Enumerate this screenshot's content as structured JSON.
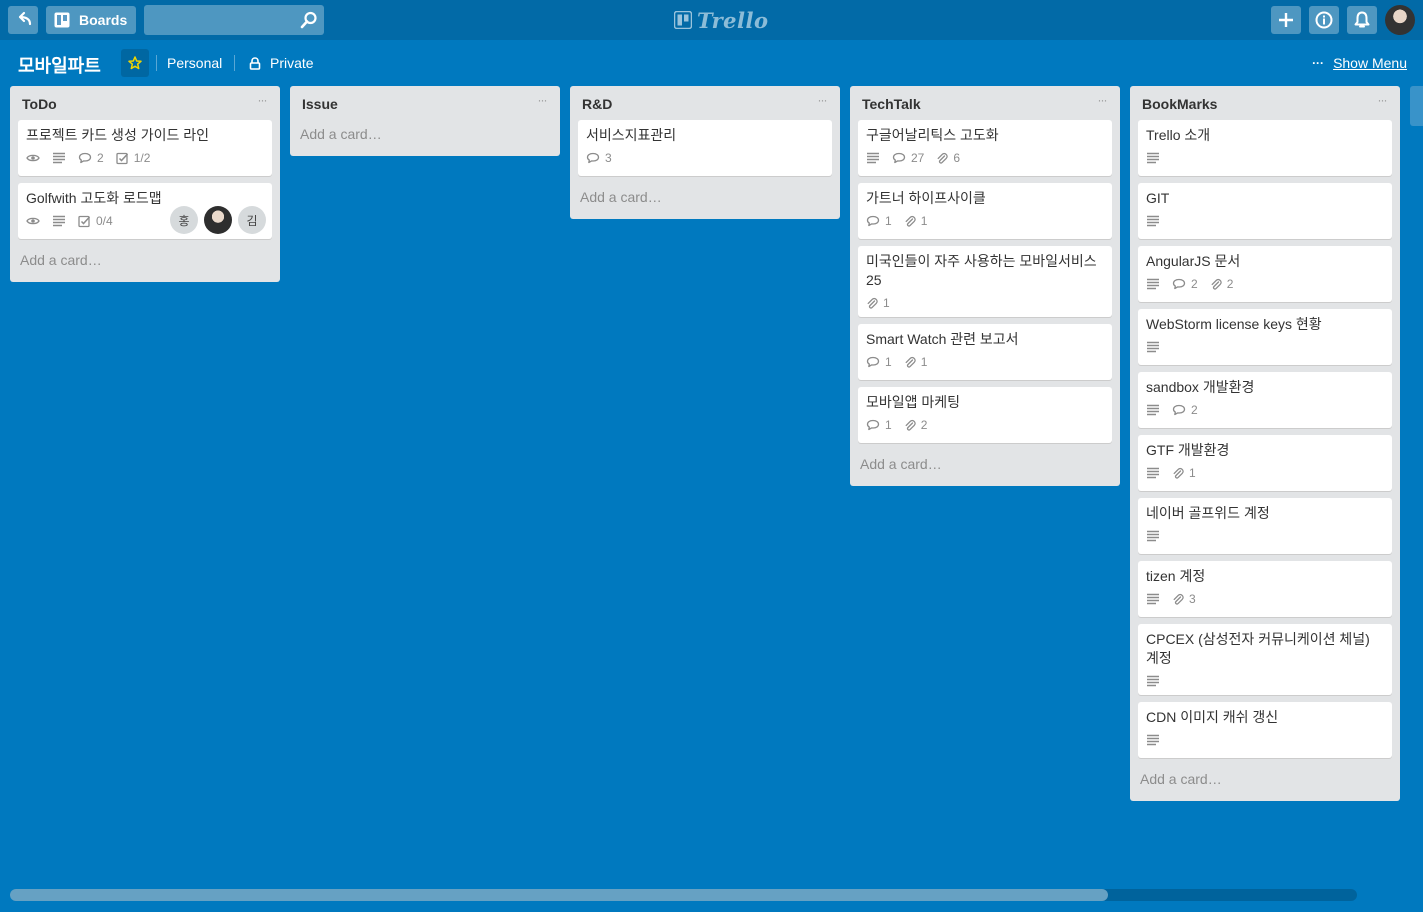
{
  "header": {
    "boards_label": "Boards",
    "search_value": "",
    "logo_text": "Trello"
  },
  "board": {
    "title": "모바일파트",
    "team": "Personal",
    "visibility": "Private",
    "show_menu": "Show Menu",
    "menu_dots": "···"
  },
  "icons": {
    "back": "back-arrow-icon",
    "boards": "boards-icon",
    "search": "search-icon",
    "add": "plus-icon",
    "info": "info-icon",
    "notifications": "bell-icon",
    "star": "star-icon",
    "lock": "lock-icon",
    "watch": "eye-icon",
    "description": "description-icon",
    "comments": "comment-icon",
    "checklist": "checklist-icon",
    "attachments": "paperclip-icon"
  },
  "colors": {
    "background": "#0079bf",
    "header": "#026aa7",
    "list": "#e2e4e6",
    "star": "#f2d600"
  },
  "lists": [
    {
      "title": "ToDo",
      "menu": "···",
      "add_card": "Add a card…",
      "cards": [
        {
          "title": "프로젝트 카드 생성 가이드 라인",
          "watch": true,
          "desc": true,
          "comments": "2",
          "checklist": "1/2",
          "attachments": null,
          "members": []
        },
        {
          "title": "Golfwith 고도화 로드맵",
          "watch": true,
          "desc": true,
          "comments": null,
          "checklist": "0/4",
          "attachments": null,
          "members": [
            "홍",
            "",
            "김"
          ]
        }
      ]
    },
    {
      "title": "Issue",
      "menu": "···",
      "add_card": "Add a card…",
      "cards": []
    },
    {
      "title": "R&D",
      "menu": "···",
      "add_card": "Add a card…",
      "cards": [
        {
          "title": "서비스지표관리",
          "watch": false,
          "desc": false,
          "comments": "3",
          "checklist": null,
          "attachments": null,
          "members": []
        }
      ]
    },
    {
      "title": "TechTalk",
      "menu": "···",
      "add_card": "Add a card…",
      "cards": [
        {
          "title": "구글어날리틱스 고도화",
          "watch": false,
          "desc": true,
          "comments": "27",
          "checklist": null,
          "attachments": "6",
          "members": []
        },
        {
          "title": "가트너 하이프사이클",
          "watch": false,
          "desc": false,
          "comments": "1",
          "checklist": null,
          "attachments": "1",
          "members": []
        },
        {
          "title": "미국인들이 자주 사용하는 모바일서비스 25",
          "watch": false,
          "desc": false,
          "comments": null,
          "checklist": null,
          "attachments": "1",
          "members": []
        },
        {
          "title": "Smart Watch 관련 보고서",
          "watch": false,
          "desc": false,
          "comments": "1",
          "checklist": null,
          "attachments": "1",
          "members": []
        },
        {
          "title": "모바일앱 마케팅",
          "watch": false,
          "desc": false,
          "comments": "1",
          "checklist": null,
          "attachments": "2",
          "members": []
        }
      ]
    },
    {
      "title": "BookMarks",
      "menu": "···",
      "add_card": "Add a card…",
      "cards": [
        {
          "title": "Trello 소개",
          "watch": false,
          "desc": true,
          "comments": null,
          "checklist": null,
          "attachments": null,
          "members": []
        },
        {
          "title": "GIT",
          "watch": false,
          "desc": true,
          "comments": null,
          "checklist": null,
          "attachments": null,
          "members": []
        },
        {
          "title": "AngularJS 문서",
          "watch": false,
          "desc": true,
          "comments": "2",
          "checklist": null,
          "attachments": "2",
          "members": []
        },
        {
          "title": "WebStorm license keys 현황",
          "watch": false,
          "desc": true,
          "comments": null,
          "checklist": null,
          "attachments": null,
          "members": []
        },
        {
          "title": "sandbox 개발환경",
          "watch": false,
          "desc": true,
          "comments": "2",
          "checklist": null,
          "attachments": null,
          "members": []
        },
        {
          "title": "GTF 개발환경",
          "watch": false,
          "desc": true,
          "comments": null,
          "checklist": null,
          "attachments": "1",
          "members": []
        },
        {
          "title": "네이버 골프위드 계정",
          "watch": false,
          "desc": true,
          "comments": null,
          "checklist": null,
          "attachments": null,
          "members": []
        },
        {
          "title": "tizen 계정",
          "watch": false,
          "desc": true,
          "comments": null,
          "checklist": null,
          "attachments": "3",
          "members": []
        },
        {
          "title": "CPCEX (삼성전자 커뮤니케이션 체널) 계정",
          "watch": false,
          "desc": true,
          "comments": null,
          "checklist": null,
          "attachments": null,
          "members": []
        },
        {
          "title": "CDN 이미지 캐쉬 갱신",
          "watch": false,
          "desc": true,
          "comments": null,
          "checklist": null,
          "attachments": null,
          "members": []
        }
      ]
    }
  ],
  "scroll": {
    "horizontal_position": 0.81
  }
}
